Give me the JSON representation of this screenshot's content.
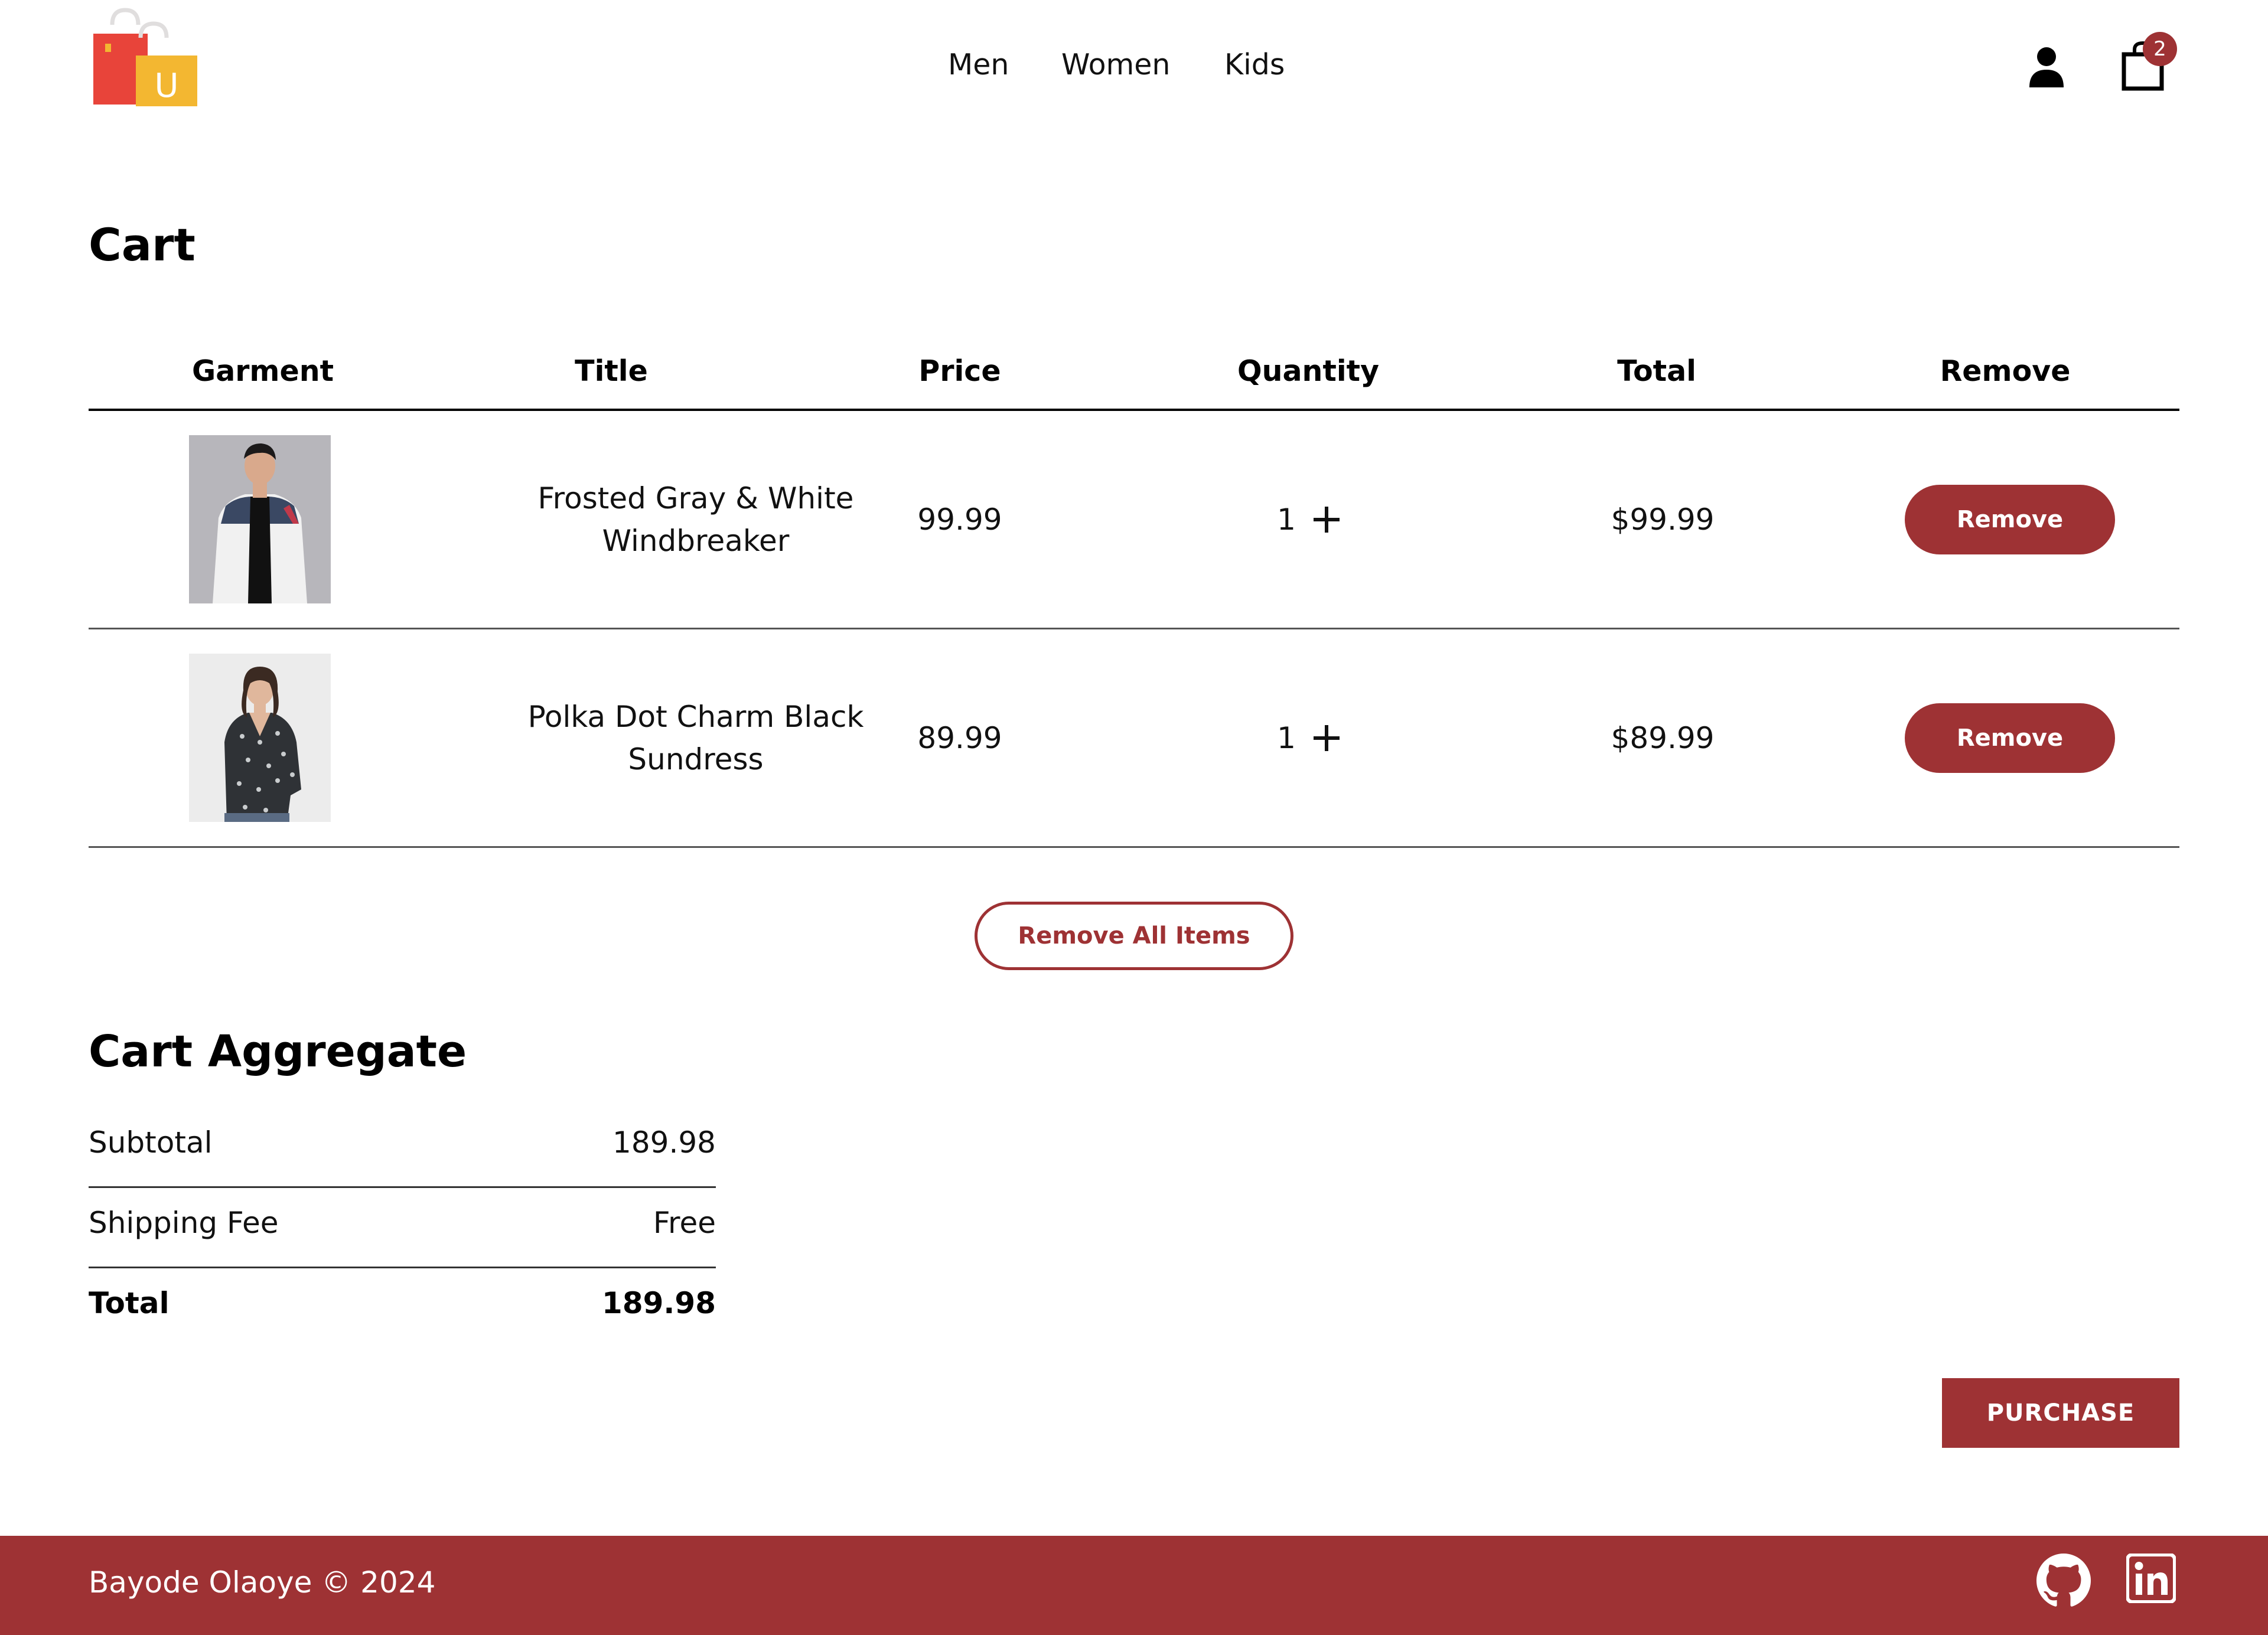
{
  "header": {
    "logo_letter": "U",
    "nav": [
      {
        "label": "Men"
      },
      {
        "label": "Women"
      },
      {
        "label": "Kids"
      }
    ],
    "icons": {
      "user": "user-icon",
      "cart": "shopping-bag-icon"
    },
    "cart_count": "2"
  },
  "cart": {
    "title": "Cart",
    "columns": [
      "Garment",
      "Title",
      "Price",
      "Quantity",
      "Total",
      "Remove"
    ],
    "items": [
      {
        "title": "Frosted Gray & White Windbreaker",
        "price": "99.99",
        "quantity": "1",
        "total": "$99.99",
        "remove_label": "Remove",
        "image": "man-in-white-windbreaker-photo"
      },
      {
        "title": "Polka Dot Charm Black Sundress",
        "price": "89.99",
        "quantity": "1",
        "total": "$89.99",
        "remove_label": "Remove",
        "image": "woman-in-polka-dot-dress-photo"
      }
    ],
    "remove_all_label": "Remove All Items"
  },
  "aggregate": {
    "title": "Cart Aggregate",
    "rows": [
      {
        "label": "Subtotal",
        "value": "189.98"
      },
      {
        "label": "Shipping Fee",
        "value": "Free"
      },
      {
        "label": "Total",
        "value": "189.98"
      }
    ],
    "purchase_label": "PURCHASE"
  },
  "footer": {
    "text": "Bayode Olaoye © 2024",
    "icons": [
      "github-icon",
      "linkedin-icon"
    ]
  },
  "colors": {
    "accent": "#9e3234",
    "logo_red": "#e8443a",
    "logo_yellow": "#f3b731"
  }
}
